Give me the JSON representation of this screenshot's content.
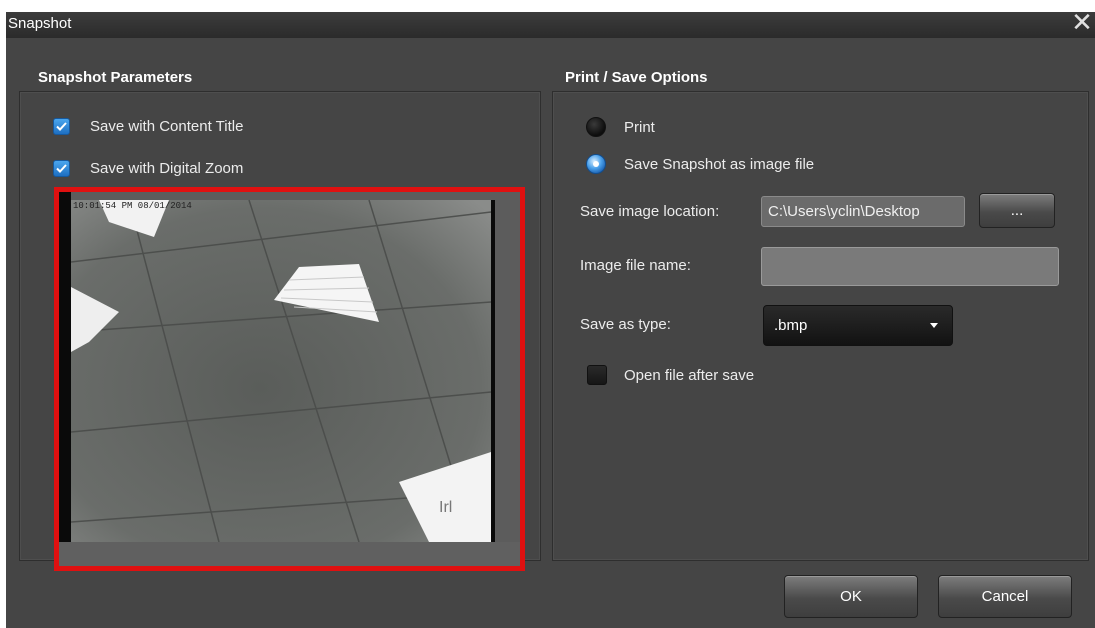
{
  "window": {
    "title": "Snapshot",
    "close_glyph": "✕"
  },
  "left": {
    "title": "Snapshot Parameters",
    "checkboxes": [
      {
        "label": "Save with Content Title",
        "checked": true
      },
      {
        "label": "Save with Digital Zoom",
        "checked": true
      }
    ],
    "preview": {
      "overlay_text": "10:01:54 PM 08/01/2014"
    }
  },
  "right": {
    "title": "Print / Save Options",
    "radios": [
      {
        "label": "Print",
        "selected": false
      },
      {
        "label": "Save Snapshot as image file",
        "selected": true
      }
    ],
    "location_label": "Save image location:",
    "location_value": "C:\\Users\\yclin\\Desktop",
    "browse_label": "...",
    "filename_label": "Image file name:",
    "filename_value": "",
    "type_label": "Save as type:",
    "type_value": ".bmp",
    "open_after_label": "Open file after save",
    "open_after_checked": false
  },
  "footer": {
    "ok_label": "OK",
    "cancel_label": "Cancel"
  },
  "colors": {
    "accent": "#1d6fc1",
    "highlight_border": "#e01010",
    "background": "#454545"
  }
}
